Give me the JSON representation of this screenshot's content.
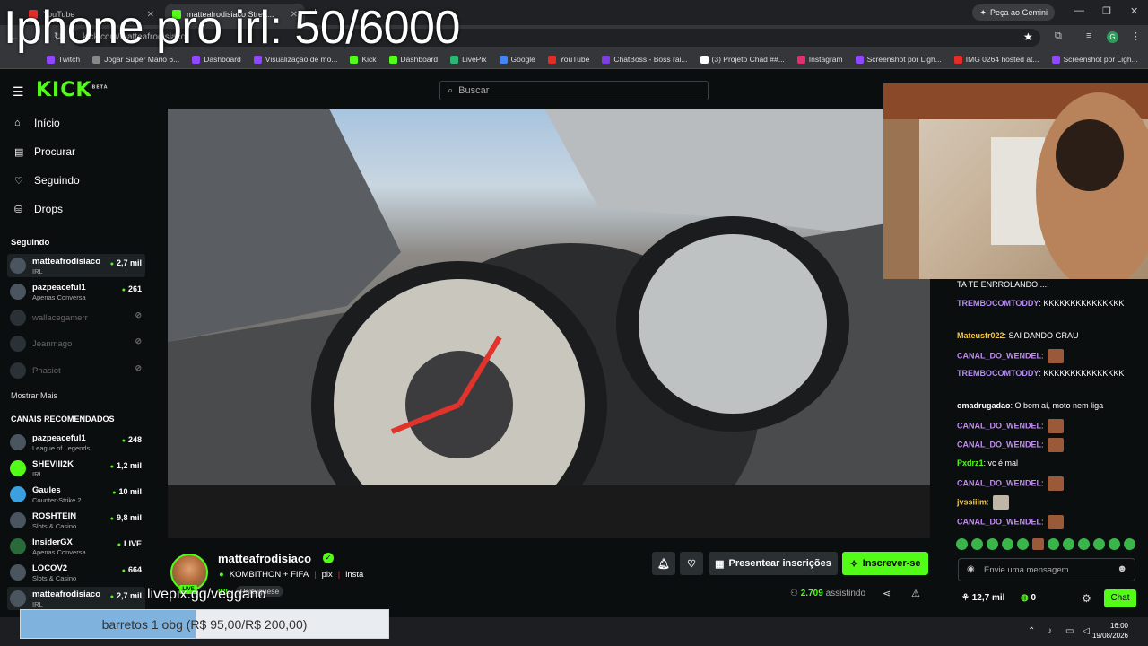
{
  "overlay": {
    "title": "Iphone pro irl: 50/6000",
    "livepix": "livepix.gg/veggano"
  },
  "browser": {
    "tabs": [
      {
        "label": "YouTube"
      },
      {
        "label": "matteafrodisiaco Strea..."
      }
    ],
    "gemini_label": "Peça ao Gemini",
    "url": "kick.com/matteafrodisiaco",
    "bookmarks": [
      "Twitch",
      "Jogar Super Mario 6...",
      "Dashboard",
      "Visualização de mo...",
      "Kick",
      "Dashboard",
      "LivePix",
      "Google",
      "YouTube",
      "ChatBoss - Boss rai...",
      "(3) Projeto Chad ##...",
      "Instagram",
      "Screenshot por Ligh...",
      "IMG 0264 hosted at...",
      "Screenshot por Ligh..."
    ]
  },
  "header": {
    "logo": "KICK",
    "logo_beta": "BETA",
    "search_placeholder": "Buscar"
  },
  "sidebar": {
    "nav": [
      {
        "label": "Início",
        "icon": "home-icon"
      },
      {
        "label": "Procurar",
        "icon": "browse-icon"
      },
      {
        "label": "Seguindo",
        "icon": "heart-icon"
      },
      {
        "label": "Drops",
        "icon": "drops-icon"
      }
    ],
    "following_header": "Seguindo",
    "following": [
      {
        "name": "matteafrodisiaco",
        "sub": "IRL",
        "viewers": "2,7 mil"
      },
      {
        "name": "pazpeaceful1",
        "sub": "Apenas Conversa",
        "viewers": "261"
      },
      {
        "name": "wallacegamerr",
        "sub": "",
        "viewers": ""
      },
      {
        "name": "Jeanmago",
        "sub": "",
        "viewers": ""
      },
      {
        "name": "Phasiot",
        "sub": "",
        "viewers": ""
      }
    ],
    "show_more": "Mostrar Mais",
    "recommended_header": "CANAIS RECOMENDADOS",
    "recommended": [
      {
        "name": "pazpeaceful1",
        "sub": "League of Legends",
        "viewers": "248"
      },
      {
        "name": "SHEVIII2K",
        "sub": "IRL",
        "viewers": "1,2 mil"
      },
      {
        "name": "Gaules",
        "sub": "Counter-Strike 2",
        "viewers": "10 mil"
      },
      {
        "name": "ROSHTEIN",
        "sub": "Slots & Casino",
        "viewers": "9,8 mil"
      },
      {
        "name": "InsiderGX",
        "sub": "Apenas Conversa",
        "viewers": "LIVE"
      },
      {
        "name": "LOCOV2",
        "sub": "Slots & Casino",
        "viewers": "664"
      },
      {
        "name": "matteafrodisiaco",
        "sub": "IRL",
        "viewers": "2,7 mil"
      }
    ]
  },
  "channel": {
    "name": "matteafrodisiaco",
    "live_badge": "LIVE",
    "title": "KOMBITHON + FIFA",
    "links": [
      "pix",
      "insta"
    ],
    "category": "IRL",
    "language": "Portuguese",
    "gift_label": "Presentear inscrições",
    "subscribe_label": "Inscrever-se",
    "viewers_count": "2.709",
    "viewers_label": "assistindo"
  },
  "chat": {
    "messages": [
      {
        "user": "",
        "text": "TA TE ENRROLANDO.....",
        "color": "#ffffff"
      },
      {
        "user": "TREMBOCOMTODDY",
        "text": "KKKKKKKKKKKKKKK",
        "color": "#b48cf2"
      },
      {
        "user": "Mateusfr022",
        "text": "SAI DANDO GRAU",
        "color": "#f2c94c"
      },
      {
        "user": "CANAL_DO_WENDEL",
        "text": "",
        "color": "#c08cf2",
        "emote": true
      },
      {
        "user": "TREMBOCOMTODDY",
        "text": "KKKKKKKKKKKKKKK",
        "color": "#b48cf2"
      },
      {
        "user": "omadrugadao",
        "text": "O bem aí, moto nem liga",
        "color": "#ffffff"
      },
      {
        "user": "CANAL_DO_WENDEL",
        "text": "",
        "color": "#c08cf2",
        "emote": true
      },
      {
        "user": "CANAL_DO_WENDEL",
        "text": "",
        "color": "#c08cf2",
        "emote": true
      },
      {
        "user": "Pxdrz1",
        "text": "vc é mal",
        "color": "#53fc18"
      },
      {
        "user": "CANAL_DO_WENDEL",
        "text": "",
        "color": "#c08cf2",
        "emote": true
      },
      {
        "user": "jvssiiim",
        "text": "",
        "color": "#f2c94c",
        "emote": true
      },
      {
        "user": "CANAL_DO_WENDEL",
        "text": "",
        "color": "#c08cf2",
        "emote": true
      }
    ],
    "input_placeholder": "Envie uma mensagem",
    "points": "12,7 mil",
    "points2": "0",
    "chat_button": "Chat"
  },
  "goal": {
    "text": "barretos 1 obg (R$ 95,00/R$ 200,00)",
    "progress": 0.475
  },
  "taskbar": {
    "time": "16:00",
    "date": "19/08/2026"
  },
  "colors": {
    "accent": "#53fc18",
    "background": "#0b0e0f"
  }
}
